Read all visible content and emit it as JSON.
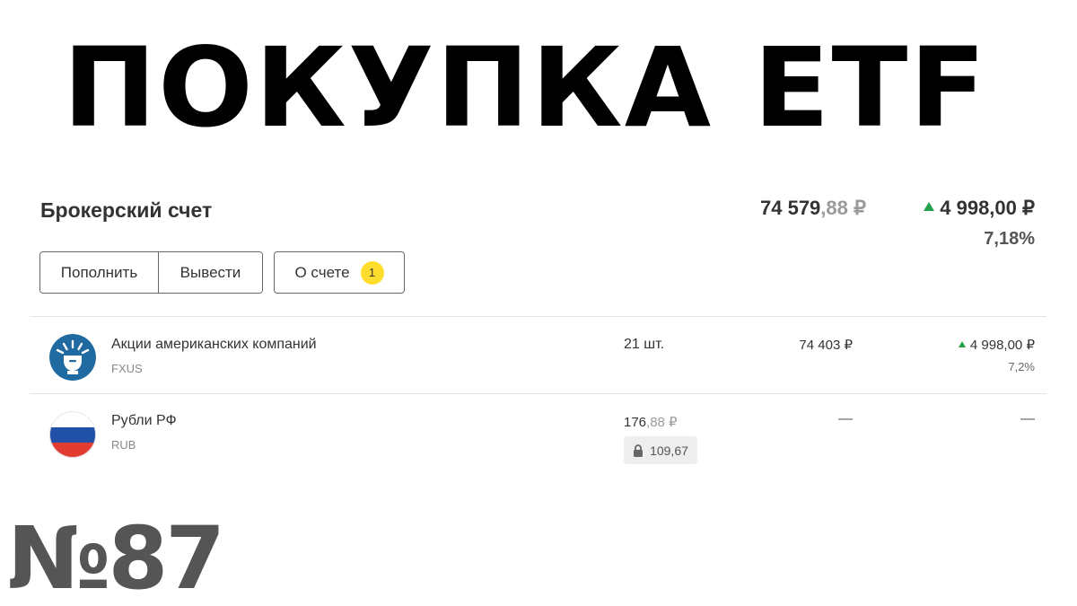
{
  "headline": "ПОКУПКА ETF",
  "account": {
    "title": "Брокерский счет",
    "total_int": "74 579",
    "total_frac": ",88 ₽",
    "change": "4 998,00 ₽",
    "change_pct": "7,18%"
  },
  "buttons": {
    "topup": "Пополнить",
    "withdraw": "Вывести",
    "about": "О счете",
    "about_badge": "1"
  },
  "positions": [
    {
      "name": "Акции американских компаний",
      "ticker": "FXUS",
      "icon": "statue-of-liberty-icon",
      "quantity": "21 шт.",
      "value": "74 403 ₽",
      "change": "4 998,00 ₽",
      "change_pct": "7,2%"
    },
    {
      "name": "Рубли РФ",
      "ticker": "RUB",
      "icon": "russian-flag-icon",
      "quantity_int": "176",
      "quantity_frac": ",88 ₽",
      "blocked": "109,67",
      "value": "—",
      "change": "—"
    }
  ],
  "issue_number": "№87",
  "colors": {
    "positive": "#22a04b",
    "badge": "#ffdd2d",
    "fxus_icon": "#1f6aa0",
    "flag_white": "#ffffff",
    "flag_blue": "#2050a8",
    "flag_red": "#e03c31"
  }
}
